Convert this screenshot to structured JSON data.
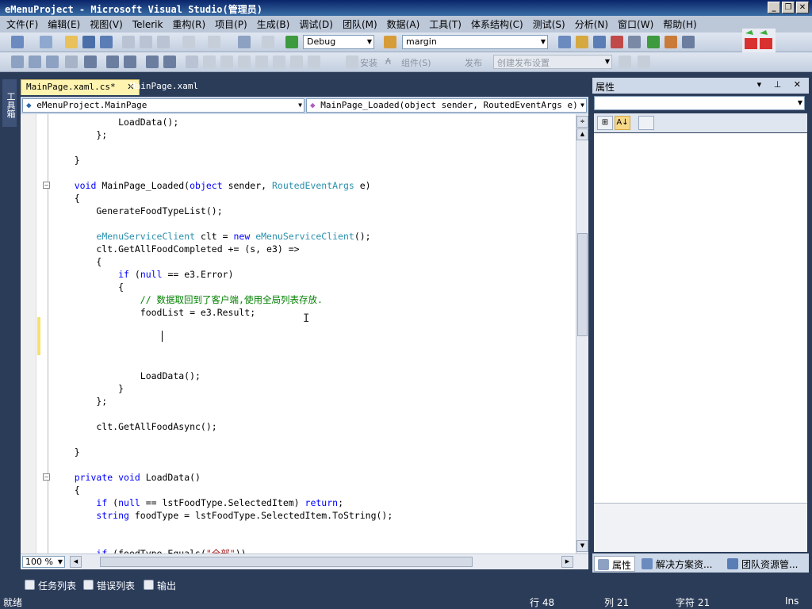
{
  "window": {
    "title": "eMenuProject - Microsoft Visual Studio(管理员)",
    "buttons": [
      "_",
      "❐",
      "✕"
    ]
  },
  "menu": [
    "文件(F)",
    "编辑(E)",
    "视图(V)",
    "Telerik",
    "重构(R)",
    "项目(P)",
    "生成(B)",
    "调试(D)",
    "团队(M)",
    "数据(A)",
    "工具(T)",
    "体系结构(C)",
    "测试(S)",
    "分析(N)",
    "窗口(W)",
    "帮助(H)"
  ],
  "toolbar": {
    "config_combo": "Debug",
    "find_combo": "margin",
    "install_label": "安装",
    "component_label": "组件(S)",
    "publish_label": "发布",
    "publish_settings": "创建发布设置"
  },
  "left_strip": {
    "toolbox_label": "工具箱"
  },
  "doc_tabs": [
    {
      "label": "MainPage.xaml.cs*",
      "active": true,
      "close": "✕"
    },
    {
      "label": "MainPage.xaml",
      "active": false
    }
  ],
  "nav": {
    "class_combo": "eMenuProject.MainPage",
    "member_combo": "MainPage_Loaded(object sender, RoutedEventArgs e)"
  },
  "code": [
    [
      {
        "t": "            LoadData();"
      }
    ],
    [
      {
        "t": "        };"
      }
    ],
    [
      {
        "t": ""
      }
    ],
    [
      {
        "t": "    }"
      }
    ],
    [
      {
        "t": ""
      }
    ],
    [
      {
        "t": "    "
      },
      {
        "t": "void",
        "c": "kw"
      },
      {
        "t": " MainPage_Loaded("
      },
      {
        "t": "object",
        "c": "kw"
      },
      {
        "t": " sender, "
      },
      {
        "t": "RoutedEventArgs",
        "c": "ty"
      },
      {
        "t": " e)"
      }
    ],
    [
      {
        "t": "    {"
      }
    ],
    [
      {
        "t": "        GenerateFoodTypeList();"
      }
    ],
    [
      {
        "t": ""
      }
    ],
    [
      {
        "t": "        "
      },
      {
        "t": "eMenuServiceClient",
        "c": "ty"
      },
      {
        "t": " clt = "
      },
      {
        "t": "new",
        "c": "kw"
      },
      {
        "t": " "
      },
      {
        "t": "eMenuServiceClient",
        "c": "ty"
      },
      {
        "t": "();"
      }
    ],
    [
      {
        "t": "        clt.GetAllFoodCompleted += (s, e3) =>"
      }
    ],
    [
      {
        "t": "        {"
      }
    ],
    [
      {
        "t": "            "
      },
      {
        "t": "if",
        "c": "kw"
      },
      {
        "t": " ("
      },
      {
        "t": "null",
        "c": "kw"
      },
      {
        "t": " == e3.Error)"
      }
    ],
    [
      {
        "t": "            {"
      }
    ],
    [
      {
        "t": "                "
      },
      {
        "t": "// 数据取回到了客户端,使用全局列表存放.",
        "c": "cm"
      }
    ],
    [
      {
        "t": "                foodList = e3.Result;"
      }
    ],
    [
      {
        "t": ""
      }
    ],
    [
      {
        "t": ""
      }
    ],
    [
      {
        "t": ""
      }
    ],
    [
      {
        "t": ""
      }
    ],
    [
      {
        "t": "                LoadData();"
      }
    ],
    [
      {
        "t": "            }"
      }
    ],
    [
      {
        "t": "        };"
      }
    ],
    [
      {
        "t": ""
      }
    ],
    [
      {
        "t": "        clt.GetAllFoodAsync();"
      }
    ],
    [
      {
        "t": ""
      }
    ],
    [
      {
        "t": "    }"
      }
    ],
    [
      {
        "t": ""
      }
    ],
    [
      {
        "t": "    "
      },
      {
        "t": "private",
        "c": "kw"
      },
      {
        "t": " "
      },
      {
        "t": "void",
        "c": "kw"
      },
      {
        "t": " LoadData()"
      }
    ],
    [
      {
        "t": "    {"
      }
    ],
    [
      {
        "t": "        "
      },
      {
        "t": "if",
        "c": "kw"
      },
      {
        "t": " ("
      },
      {
        "t": "null",
        "c": "kw"
      },
      {
        "t": " == lstFoodType.SelectedItem) "
      },
      {
        "t": "return",
        "c": "kw"
      },
      {
        "t": ";"
      }
    ],
    [
      {
        "t": "        "
      },
      {
        "t": "string",
        "c": "kw"
      },
      {
        "t": " foodType = lstFoodType.SelectedItem.ToString();"
      }
    ],
    [
      {
        "t": ""
      }
    ],
    [
      {
        "t": ""
      }
    ],
    [
      {
        "t": "        "
      },
      {
        "t": "if",
        "c": "kw"
      },
      {
        "t": " (foodType.Equals("
      },
      {
        "t": "\"全部\"",
        "c": "st"
      },
      {
        "t": "))"
      }
    ]
  ],
  "editor": {
    "zoom": "100 %"
  },
  "properties": {
    "title": "属性",
    "header_buttons": "▾ ⊥ ✕",
    "sort_category": "⊞",
    "sort_alpha": "A↓",
    "tabs": [
      "属性",
      "解决方案资...",
      "团队资源管..."
    ]
  },
  "output_tabs": [
    "任务列表",
    "错误列表",
    "输出"
  ],
  "status": {
    "ready": "就绪",
    "line": "行 48",
    "col": "列 21",
    "ch": "字符 21",
    "mode": "Ins"
  },
  "colors": {
    "keyword": "#0000ff",
    "type": "#2b91af",
    "comment": "#008000",
    "chrome": "#2b3c59"
  }
}
